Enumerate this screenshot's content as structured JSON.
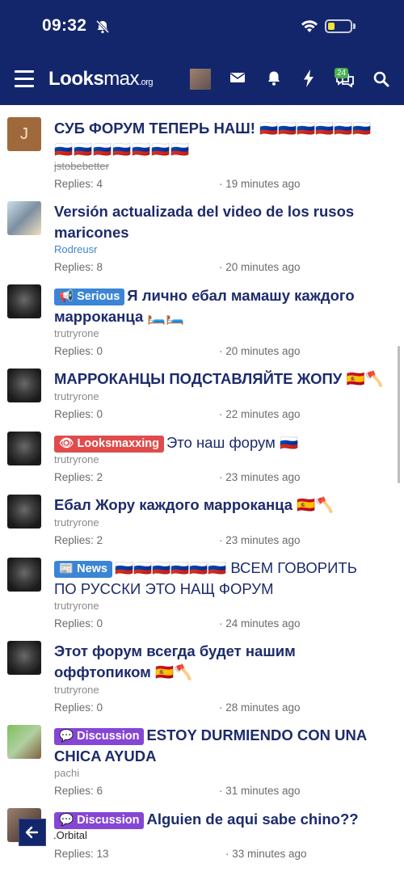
{
  "status_bar": {
    "time": "09:32"
  },
  "header": {
    "logo": {
      "main": "Looks",
      "bold2": "max",
      "suffix": ".org"
    },
    "conversations_badge": "24",
    "icons": [
      "menu-icon",
      "mail-icon",
      "bell-icon",
      "bolt-icon",
      "chat-icon",
      "search-icon"
    ]
  },
  "threads": [
    {
      "flags_pre": "",
      "title": "СУБ ФОРУМ ТЕПЕРЬ НАШ! 🇷🇺🇷🇺🇷🇺🇷🇺🇷🇺🇷🇺",
      "title2": "🇷🇺🇷🇺🇷🇺🇷🇺🇷🇺🇷🇺🇷🇺",
      "author": "jstobebetter",
      "replies": "Replies: 4",
      "time": "· 19 minutes ago"
    },
    {
      "title": "Versión actualizada del video de los rusos",
      "title2": "maricones",
      "author": "Rodreusr",
      "replies": "Replies: 8",
      "time": "· 20 minutes ago"
    },
    {
      "tag": "Serious",
      "title": "Я лично ебал мамашу каждого",
      "title2": "марроканца 🛏️🛏️",
      "author": "trutryrone",
      "replies": "Replies: 0",
      "time": "· 20 minutes ago"
    },
    {
      "title": "МАРРОКАНЦЫ ПОДСТАВЛЯЙТЕ ЖОПУ 🇪🇸🪓",
      "author": "trutryrone",
      "replies": "Replies: 0",
      "time": "· 22 minutes ago"
    },
    {
      "tag": "Looksmaxxing",
      "title": "Это наш форум 🇷🇺",
      "author": "trutryrone",
      "replies": "Replies: 2",
      "time": "· 23 minutes ago"
    },
    {
      "title": "Ебал Жору каждого марроканца 🇪🇸🪓",
      "author": "trutryrone",
      "replies": "Replies: 2",
      "time": "· 23 minutes ago"
    },
    {
      "tag": "News",
      "title": "🇷🇺🇷🇺🇷🇺🇷🇺🇷🇺🇷🇺 ВСЕМ ГОВОРИТЬ",
      "title2": "ПО РУССКИ ЭТО НАЩ ФОРУМ",
      "author": "trutryrone",
      "replies": "Replies: 0",
      "time": "· 24 minutes ago"
    },
    {
      "title": "Этот форум всегда будет нашим",
      "title2": "оффтопиком 🇪🇸🪓",
      "author": "trutryrone",
      "replies": "Replies: 0",
      "time": "· 28 minutes ago"
    },
    {
      "tag": "Discussion",
      "title": "ESTOY DURMIENDO CON UNA",
      "title2": "CHICA AYUDA",
      "author": "pachi",
      "replies": "Replies: 6",
      "time": "· 31 minutes ago"
    },
    {
      "tag": "Discussion",
      "title": "Alguien de aqui sabe chino??",
      "author": ".Orbital",
      "replies": "Replies: 13",
      "time": "· 33 minutes ago"
    }
  ],
  "colors": {
    "header_bg": "#14266b",
    "title": "#1d2b6b",
    "tag_serious": "#3a85d6",
    "tag_looksmaxxing": "#e04c4c",
    "tag_news": "#3a85d6",
    "tag_discussion": "#8546d6"
  }
}
